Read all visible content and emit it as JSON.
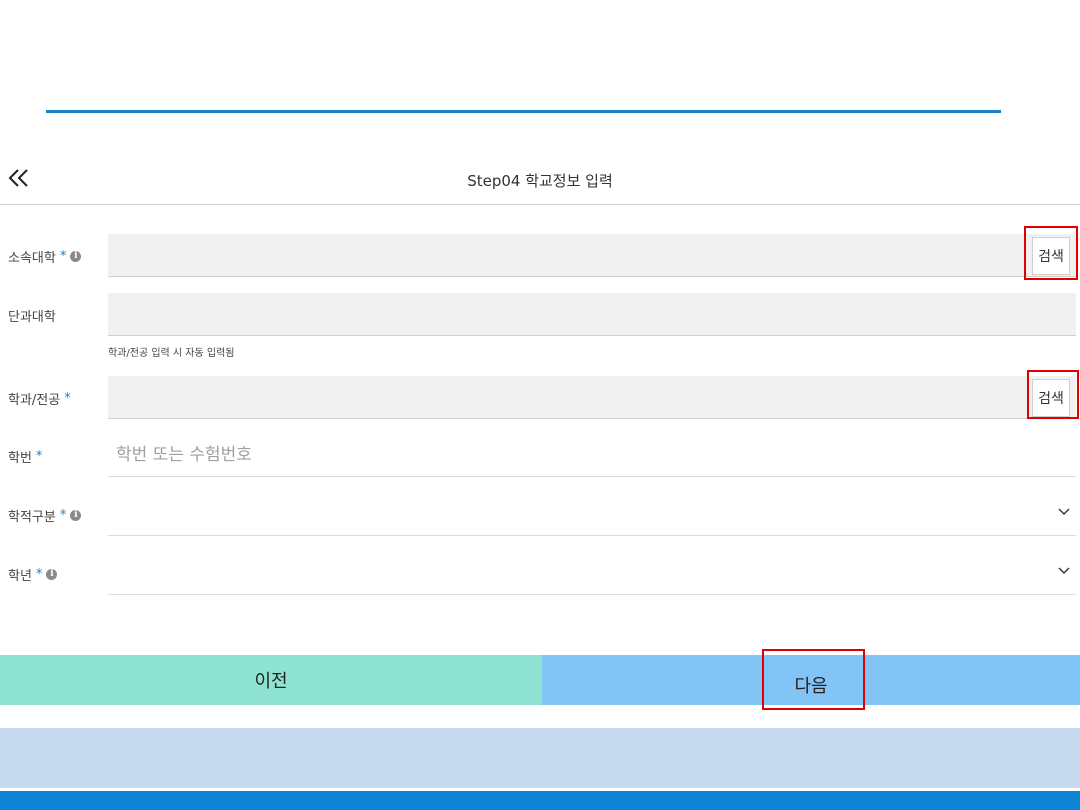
{
  "header": {
    "back_icon": "double-chevron-left-icon",
    "title": "Step04 학교정보 입력"
  },
  "form": {
    "university": {
      "label": "소속대학",
      "required_mark": "*",
      "info_icon": "info-icon",
      "value": "",
      "search_label": "검색"
    },
    "college": {
      "label": "단과대학",
      "value": "",
      "hint": "학과/전공 입력 시 자동 입력됨"
    },
    "department": {
      "label": "학과/전공",
      "required_mark": "*",
      "value": "",
      "search_label": "검색"
    },
    "student_id": {
      "label": "학번",
      "required_mark": "*",
      "placeholder": "학번 또는 수험번호",
      "value": ""
    },
    "status": {
      "label": "학적구분",
      "required_mark": "*",
      "info_icon": "info-icon",
      "selected": ""
    },
    "grade": {
      "label": "학년",
      "required_mark": "*",
      "info_icon": "info-icon",
      "selected": ""
    }
  },
  "buttons": {
    "prev_label": "이전",
    "next_label": "다음"
  },
  "colors": {
    "accent_blue": "#1a7fc8",
    "prev_button": "#8fe3d2",
    "next_button": "#82c4f5",
    "highlight": "#e00000",
    "footer_light": "#c7d9ef",
    "footer_blue": "#0d84d4"
  }
}
